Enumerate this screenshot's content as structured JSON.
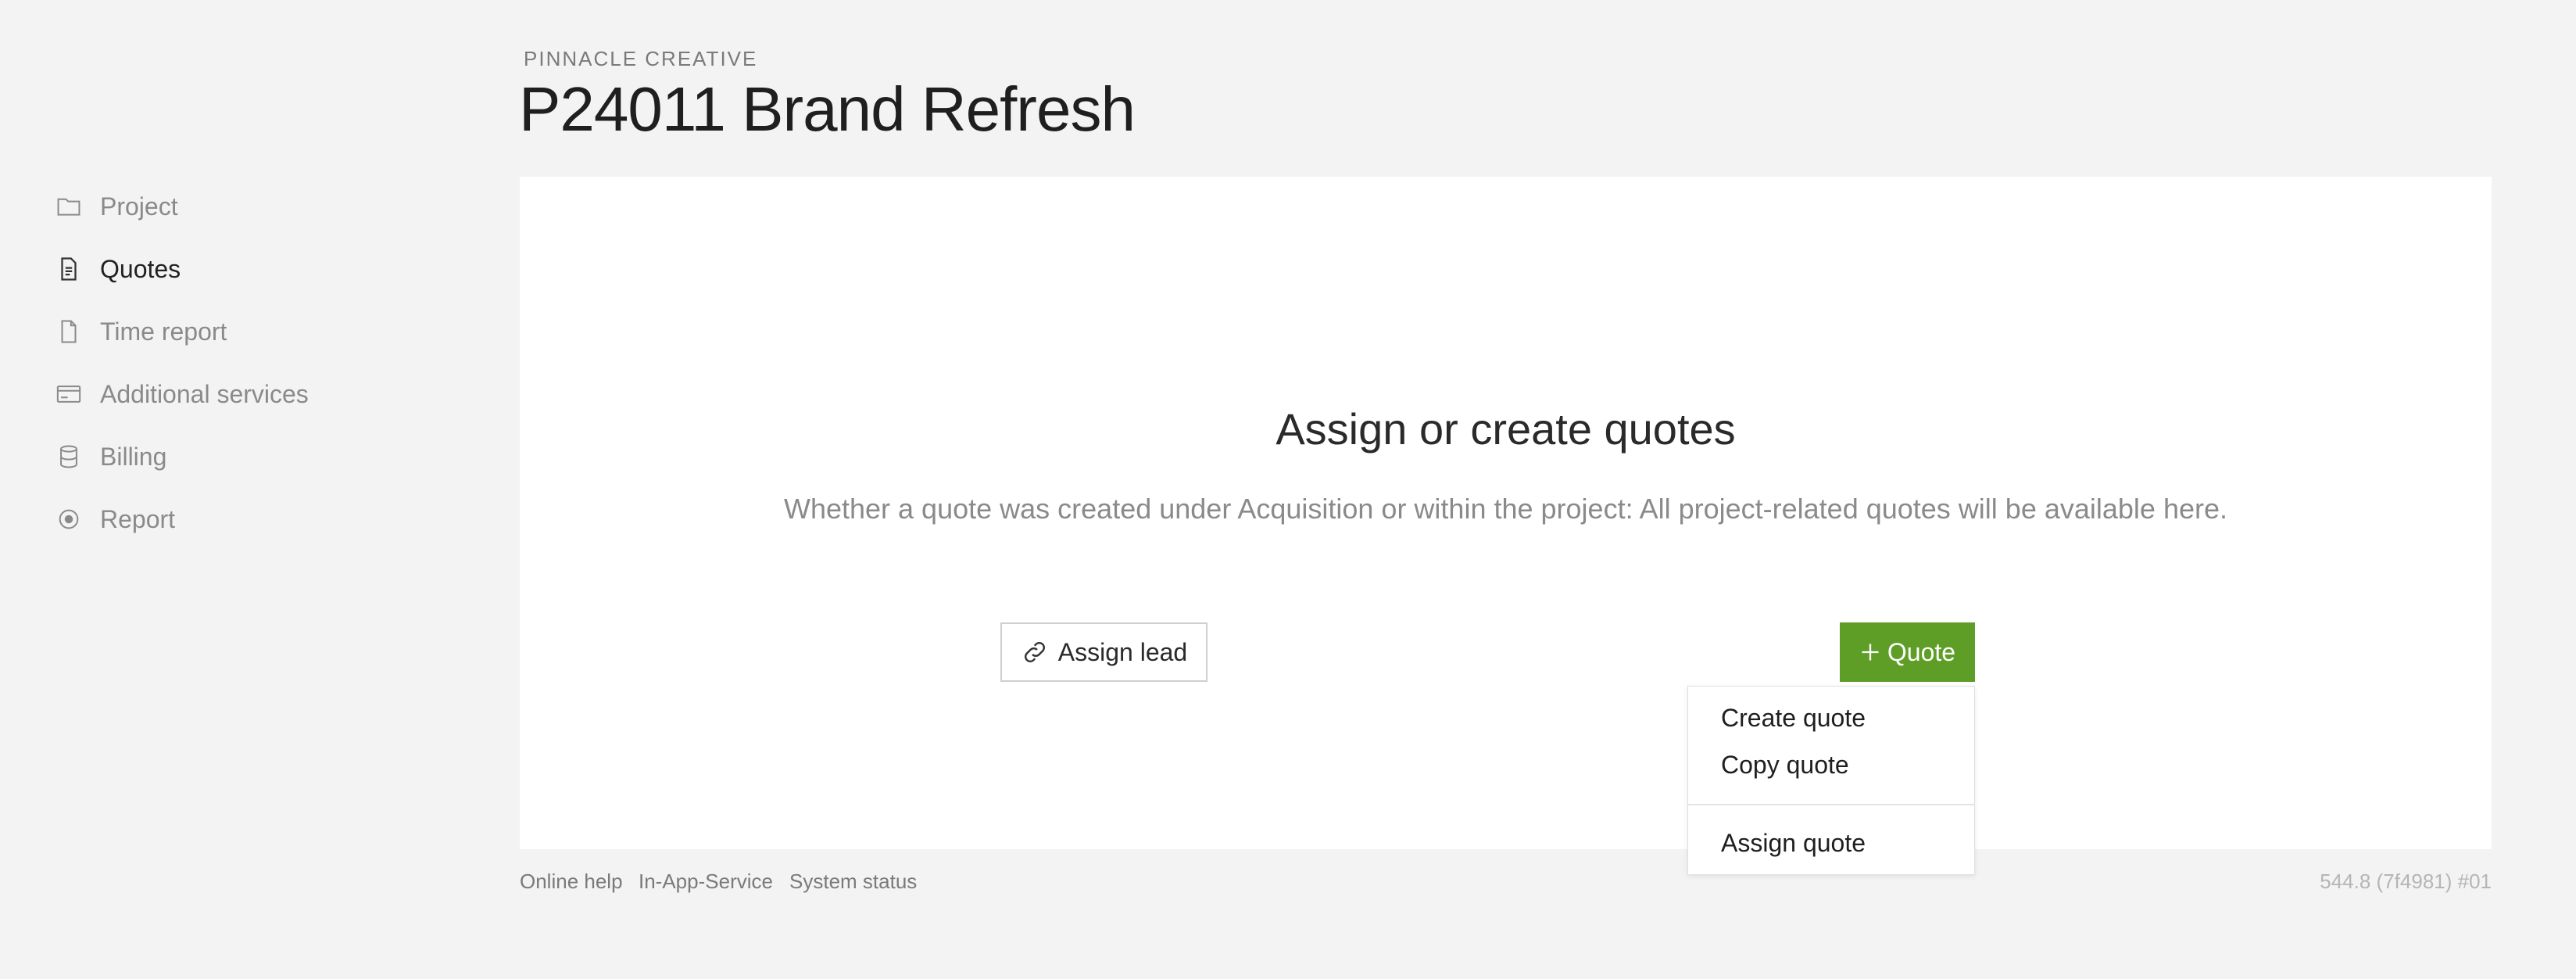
{
  "header": {
    "company": "PINNACLE CREATIVE",
    "title": "P24011 Brand Refresh"
  },
  "sidebar": {
    "items": [
      {
        "label": "Project",
        "icon": "folder-icon",
        "active": false
      },
      {
        "label": "Quotes",
        "icon": "quote-document-icon",
        "active": true
      },
      {
        "label": "Time report",
        "icon": "file-icon",
        "active": false
      },
      {
        "label": "Additional services",
        "icon": "credit-card-icon",
        "active": false
      },
      {
        "label": "Billing",
        "icon": "database-icon",
        "active": false
      },
      {
        "label": "Report",
        "icon": "target-icon",
        "active": false
      }
    ]
  },
  "main": {
    "title": "Assign or create quotes",
    "description": "Whether a quote was created under Acquisition or within the project: All project-related quotes will be available here.",
    "assign_lead_label": "Assign lead",
    "quote_button_label": "Quote"
  },
  "dropdown": {
    "items": [
      "Create quote",
      "Copy quote",
      "Assign quote"
    ]
  },
  "footer": {
    "links": [
      "Online help",
      "In-App-Service",
      "System status"
    ],
    "version": "544.8 (7f4981) #01"
  },
  "colors": {
    "accent": "#5e9e26",
    "background": "#f3f3f3",
    "card": "#ffffff"
  }
}
